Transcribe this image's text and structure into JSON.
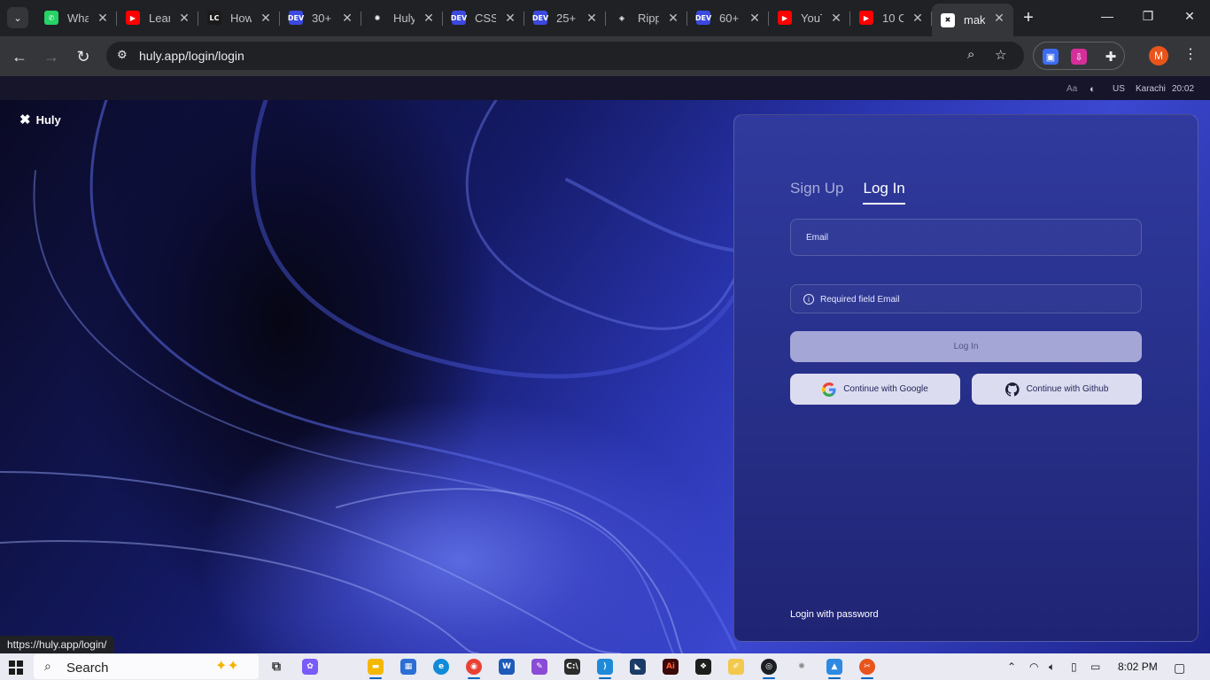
{
  "browser": {
    "tabs": [
      {
        "title": "WhatsApp",
        "favicon": "whatsapp-icon",
        "color": "#25d366",
        "glyph": "✆"
      },
      {
        "title": "Learn",
        "favicon": "youtube-icon",
        "color": "#ff0000",
        "glyph": "▶"
      },
      {
        "title": "How",
        "favicon": "leetcode-icon",
        "color": "#1a1a1a",
        "glyph": "LC"
      },
      {
        "title": "30+",
        "favicon": "dev-icon",
        "color": "#3b49df",
        "glyph": "DEV"
      },
      {
        "title": "Huly",
        "favicon": "openai-icon",
        "color": "#202124",
        "glyph": "✺"
      },
      {
        "title": "CSS",
        "favicon": "dev-icon",
        "color": "#3b49df",
        "glyph": "DEV"
      },
      {
        "title": "25+",
        "favicon": "dev-icon",
        "color": "#3b49df",
        "glyph": "DEV"
      },
      {
        "title": "Ripple",
        "favicon": "ripple-icon",
        "color": "#202124",
        "glyph": "◈"
      },
      {
        "title": "60+",
        "favicon": "dev-icon",
        "color": "#3b49df",
        "glyph": "DEV"
      },
      {
        "title": "YouTube",
        "favicon": "youtube-icon",
        "color": "#ff0000",
        "glyph": "▶"
      },
      {
        "title": "10 C",
        "favicon": "youtube-icon",
        "color": "#ff0000",
        "glyph": "▶"
      },
      {
        "title": "mak",
        "favicon": "huly-icon",
        "color": "#ffffff",
        "glyph": "✖",
        "active": true
      }
    ],
    "url": "huly.app/login/login",
    "profile_initial": "M",
    "status_url": "https://huly.app/login/"
  },
  "appbar": {
    "font_toggle": "Aa",
    "lang": "US",
    "city": "Karachi",
    "time": "20:02"
  },
  "brand": {
    "name": "Huly"
  },
  "login": {
    "tab_signup": "Sign Up",
    "tab_login": "Log In",
    "email_label": "Email",
    "error_message": "Required field Email",
    "login_button": "Log In",
    "google_button": "Continue with Google",
    "github_button": "Continue with Github",
    "password_link": "Login with password"
  },
  "taskbar": {
    "search_label": "Search",
    "time": "8:02 PM"
  },
  "colors": {
    "card_top": "#303a9e",
    "card_bottom": "#202474",
    "login_button_bg": "#a4a7d6",
    "oauth_button_bg": "#dcdcf0"
  }
}
